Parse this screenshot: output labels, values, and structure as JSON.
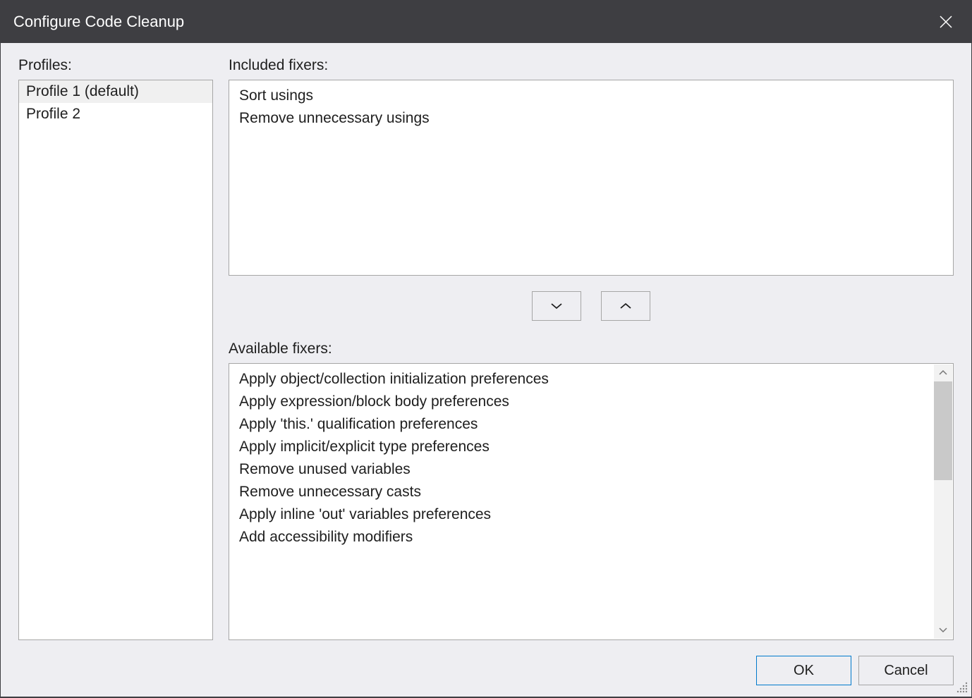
{
  "titlebar": {
    "title": "Configure Code Cleanup"
  },
  "profiles": {
    "label": "Profiles:",
    "items": [
      {
        "label": "Profile 1 (default)",
        "selected": true
      },
      {
        "label": "Profile 2",
        "selected": false
      }
    ]
  },
  "included": {
    "label": "Included fixers:",
    "items": [
      "Sort usings",
      "Remove unnecessary usings"
    ]
  },
  "available": {
    "label": "Available fixers:",
    "items": [
      "Apply object/collection initialization preferences",
      "Apply expression/block body preferences",
      "Apply 'this.' qualification preferences",
      "Apply implicit/explicit type preferences",
      "Remove unused variables",
      "Remove unnecessary casts",
      "Apply inline 'out' variables preferences",
      "Add accessibility modifiers"
    ]
  },
  "buttons": {
    "ok": "OK",
    "cancel": "Cancel"
  }
}
